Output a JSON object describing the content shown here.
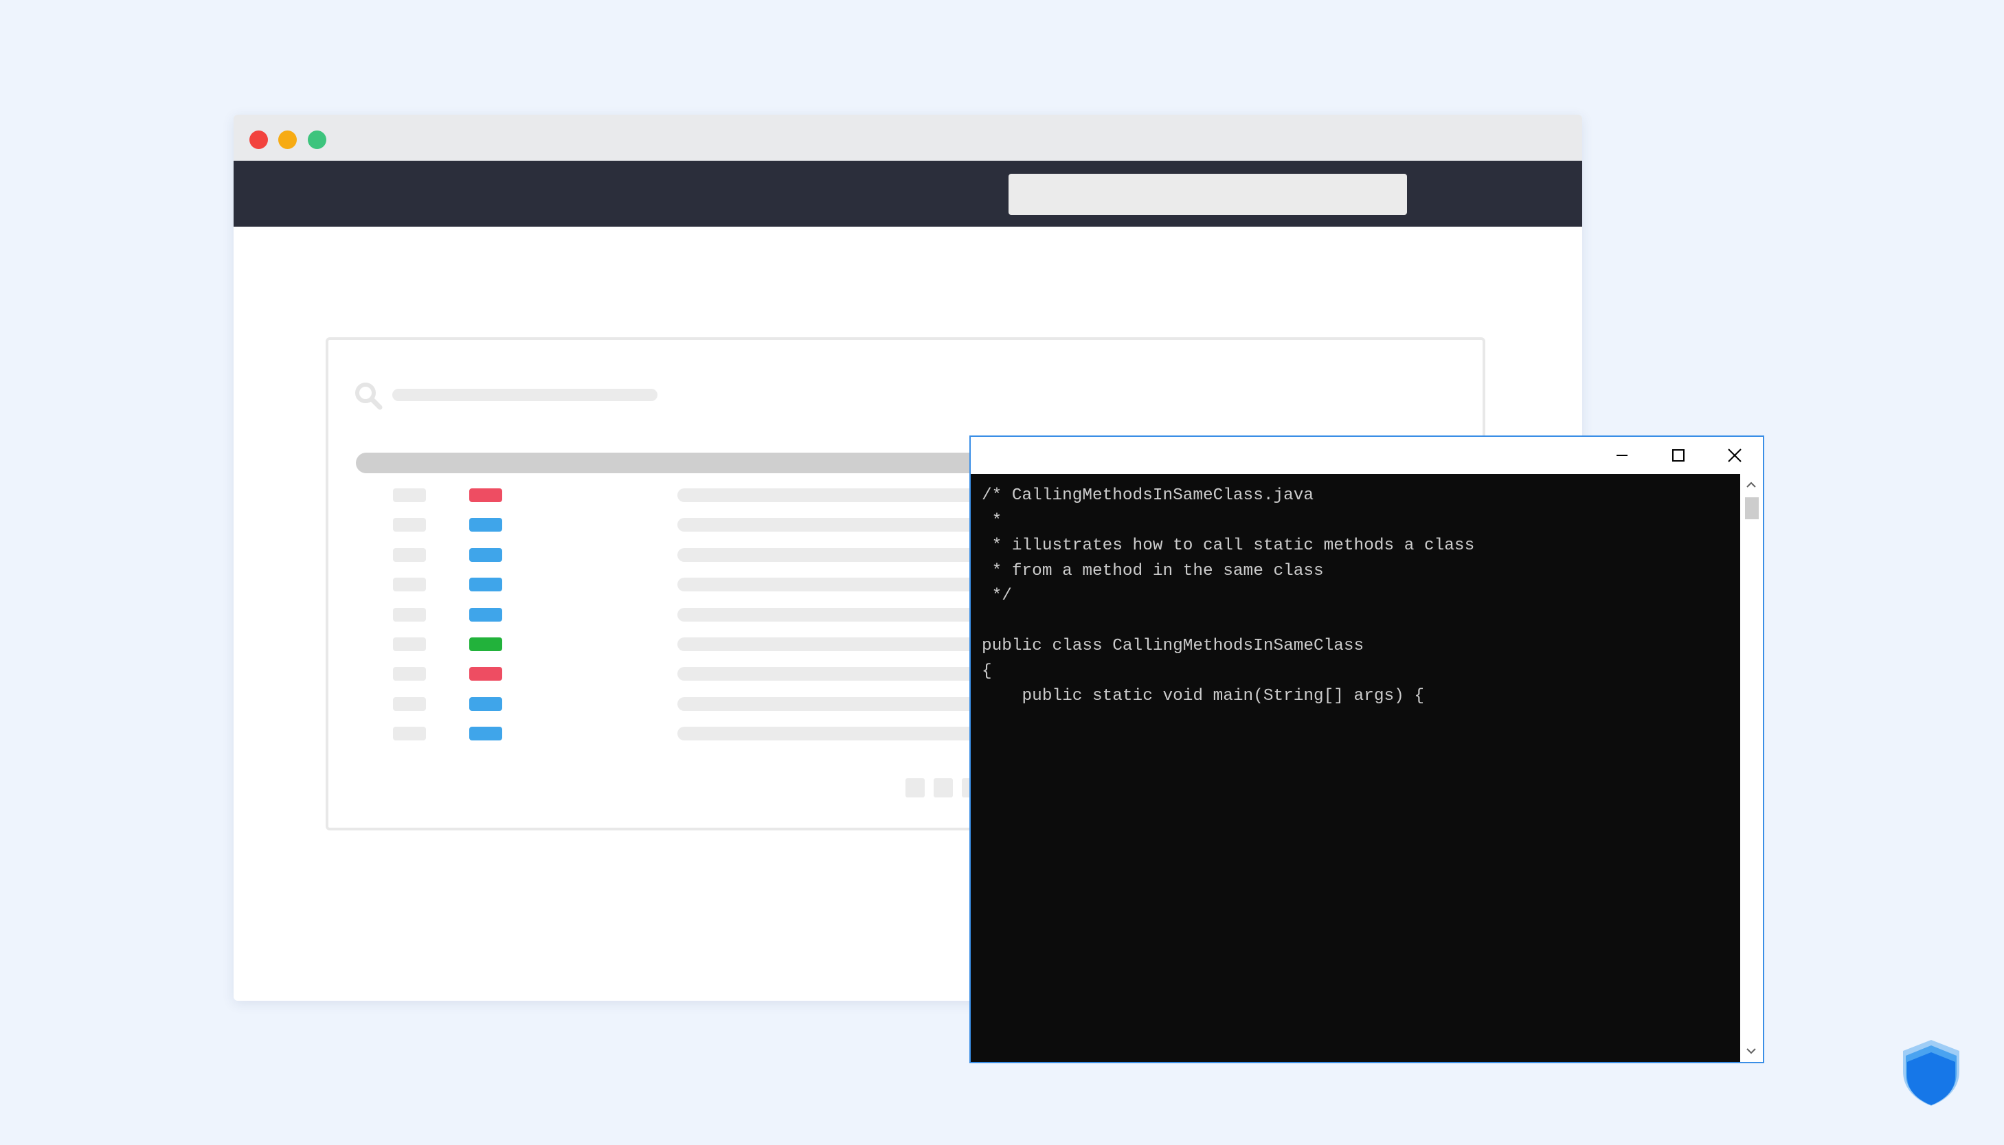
{
  "colors": {
    "background": "#eef4fd",
    "navbar": "#2b2e3b",
    "tag_red": "#ee4d62",
    "tag_blue": "#3fa5ea",
    "tag_green": "#22b23b",
    "console_bg": "#0c0c0c",
    "console_text": "#cccccc",
    "console_border": "#3a8ee6"
  },
  "browser": {
    "traffic_lights": [
      "close-dot",
      "minimize-dot",
      "zoom-dot"
    ],
    "table_rows": [
      {
        "tag_color": "red"
      },
      {
        "tag_color": "blue"
      },
      {
        "tag_color": "blue"
      },
      {
        "tag_color": "blue"
      },
      {
        "tag_color": "blue"
      },
      {
        "tag_color": "green"
      },
      {
        "tag_color": "red"
      },
      {
        "tag_color": "blue"
      },
      {
        "tag_color": "blue"
      }
    ],
    "pager_count": 3
  },
  "console": {
    "title_buttons": {
      "minimize_icon": "minimize-icon",
      "maximize_icon": "maximize-icon",
      "close_icon": "close-icon"
    },
    "lines": [
      "/* CallingMethodsInSameClass.java",
      " *",
      " * illustrates how to call static methods a class",
      " * from a method in the same class",
      " */",
      "",
      "public class CallingMethodsInSameClass",
      "{",
      "    public static void main(String[] args) {"
    ]
  },
  "logo": {
    "icon": "shield-icon"
  }
}
